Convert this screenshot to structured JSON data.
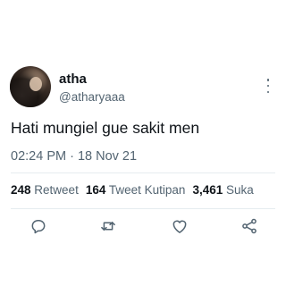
{
  "tweet": {
    "display_name": "atha",
    "handle": "@atharyaaa",
    "text": "Hati mungiel gue sakit men",
    "timestamp": "02:24 PM · 18 Nov 21"
  },
  "stats": {
    "retweet_count": "248",
    "retweet_label": "Retweet",
    "quote_count": "164",
    "quote_label": "Tweet Kutipan",
    "like_count": "3,461",
    "like_label": "Suka"
  },
  "actions": {
    "icons": [
      "reply-icon",
      "retweet-icon",
      "like-icon",
      "share-icon"
    ]
  },
  "colors": {
    "text": "#0f1419",
    "secondary": "#536471",
    "divider": "#e6ecf0"
  }
}
